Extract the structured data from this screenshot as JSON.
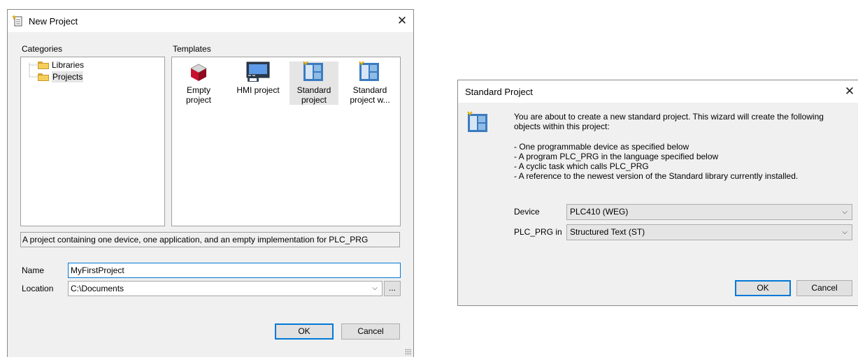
{
  "new_project": {
    "title": "New Project",
    "categories_label": "Categories",
    "templates_label": "Templates",
    "categories": [
      {
        "label": "Libraries"
      },
      {
        "label": "Projects",
        "selected": true
      }
    ],
    "templates": [
      {
        "label": "Empty project",
        "icon": "cube-icon"
      },
      {
        "label": "HMI project",
        "icon": "monitor-icon"
      },
      {
        "label": "Standard project",
        "icon": "standard-project-icon",
        "selected": true
      },
      {
        "label": "Standard project w...",
        "icon": "standard-project-icon"
      }
    ],
    "description": "A project containing one device, one application, and an empty implementation for PLC_PRG",
    "name_label": "Name",
    "name_value": "MyFirstProject",
    "location_label": "Location",
    "location_value": "C:\\Documents",
    "browse_label": "...",
    "ok_label": "OK",
    "cancel_label": "Cancel"
  },
  "standard_project": {
    "title": "Standard Project",
    "intro": "You are about to create a new standard project. This wizard will create the following objects within this project:",
    "bullets": [
      "- One programmable device as specified below",
      "- A program PLC_PRG in the language specified below",
      "- A cyclic task which calls PLC_PRG",
      "- A reference to the newest version of the Standard library currently installed."
    ],
    "device_label": "Device",
    "device_value": "PLC410 (WEG)",
    "language_label": "PLC_PRG in",
    "language_value": "Structured Text (ST)",
    "ok_label": "OK",
    "cancel_label": "Cancel"
  },
  "colors": {
    "accent": "#0078d7",
    "dialog_bg": "#f0f0f0",
    "folder": "#f5cf5a"
  }
}
